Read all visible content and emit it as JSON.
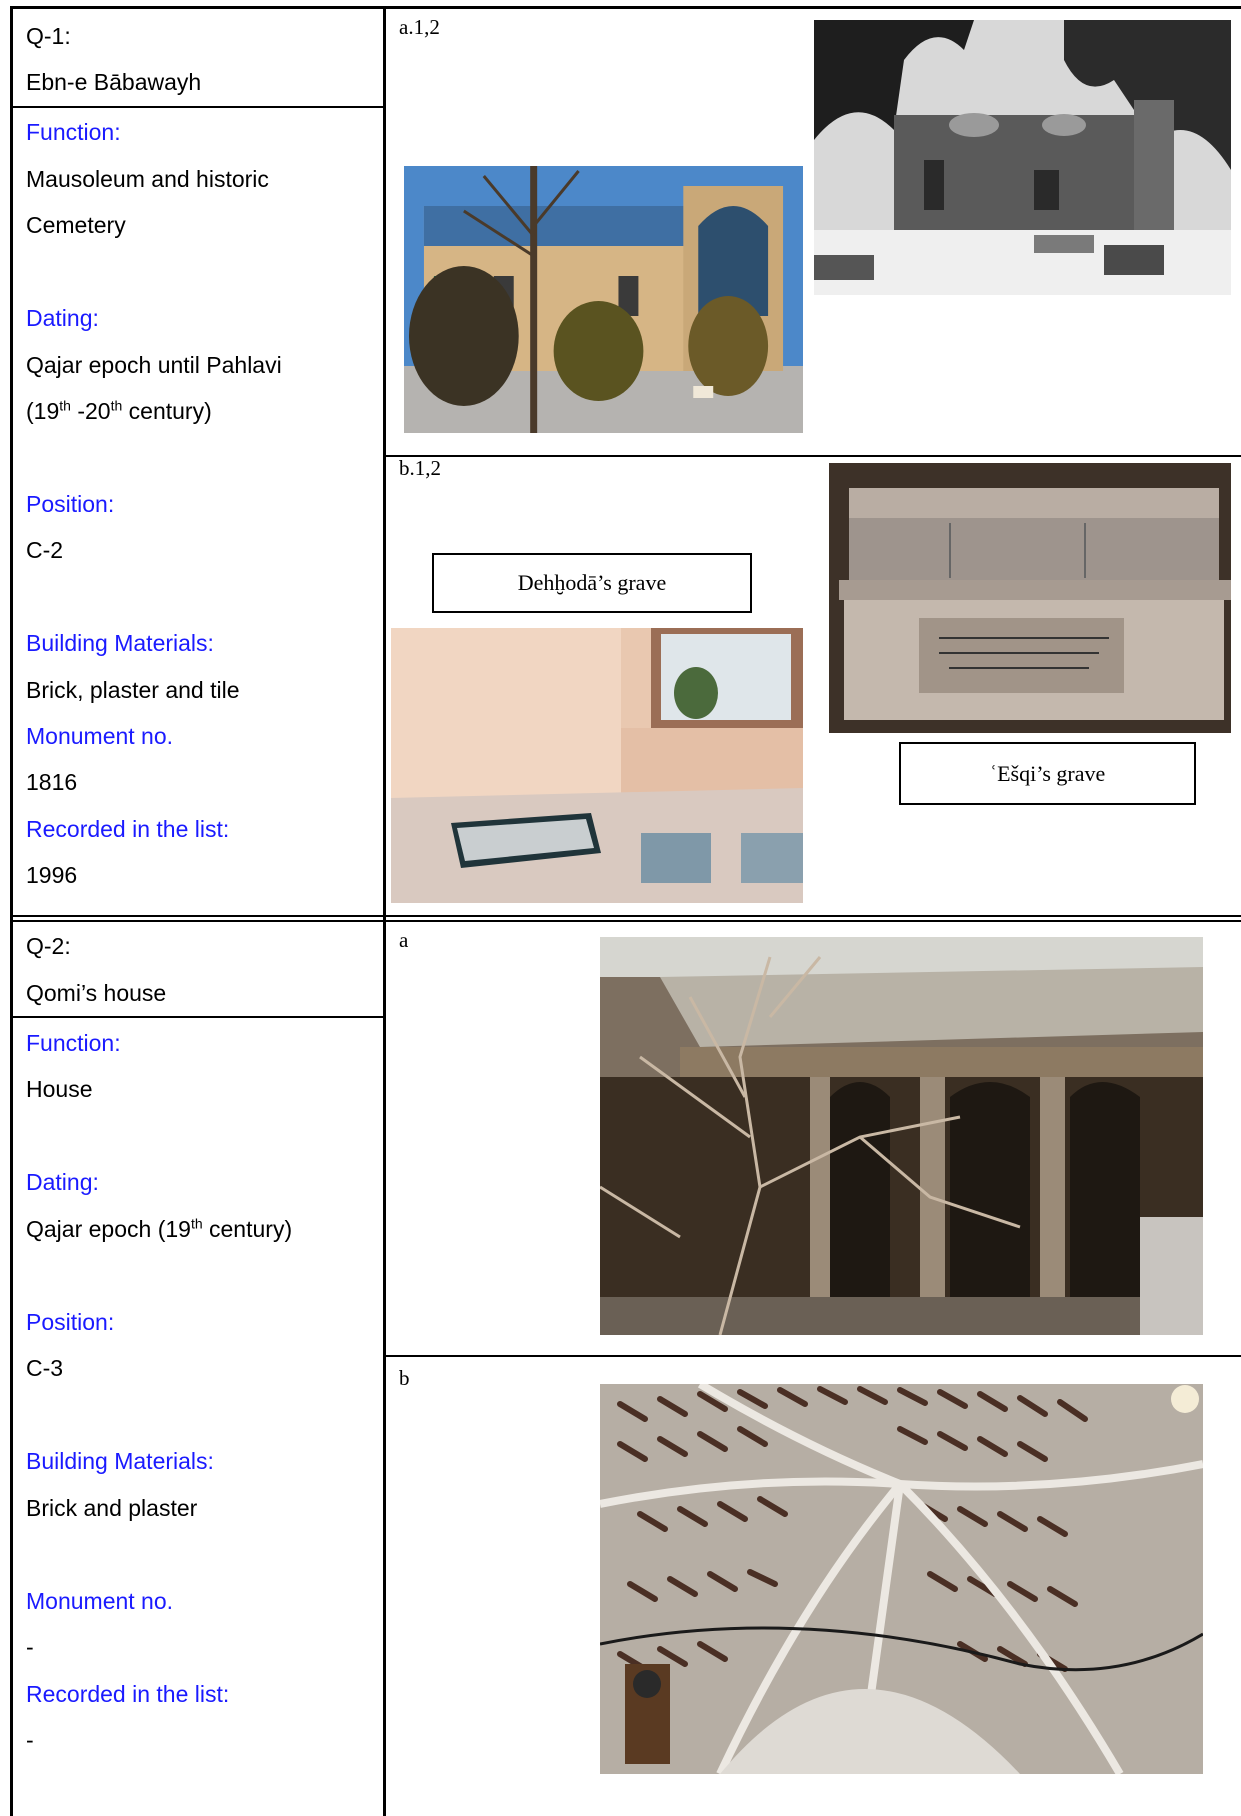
{
  "q1": {
    "id": "Q-1:",
    "name": "Ebn-e Bābawayh",
    "function_label": "Function:",
    "function_value_1": "Mausoleum and  historic",
    "function_value_2": "Cemetery",
    "dating_label": "Dating:",
    "dating_value_1": "Qajar epoch until Pahlavi",
    "dating_pre": "(19",
    "dating_sup1": "th",
    "dating_mid": " -20",
    "dating_sup2": "th",
    "dating_post": " century)",
    "position_label": "Position:",
    "position_value": "C-2",
    "materials_label": "Building Materials:",
    "materials_value": "Brick, plaster and tile",
    "monument_label": "Monument no.",
    "monument_value": "1816",
    "recorded_label": "Recorded in the list:",
    "recorded_value": "1996",
    "tag_a": "a.1,2",
    "tag_b": "b.1,2",
    "caption_dehkhoda": "Dehḫodā’s grave",
    "caption_eshqi": "ʿEšqi’s grave"
  },
  "q2": {
    "id": "Q-2:",
    "name": "Qomi’s house",
    "function_label": "Function:",
    "function_value": "House",
    "dating_label": "Dating:",
    "dating_pre": "Qajar epoch (19",
    "dating_sup": "th",
    "dating_post": " century)",
    "position_label": "Position:",
    "position_value": "C-3",
    "materials_label": "Building Materials:",
    "materials_value": "Brick and plaster",
    "monument_label": "Monument no.",
    "monument_value": "-",
    "recorded_label": "Recorded in the list:",
    "recorded_value": "-",
    "tag_a": "a",
    "tag_b": "b"
  },
  "colors": {
    "label_blue": "#1a1aff",
    "rule": "#000000"
  }
}
